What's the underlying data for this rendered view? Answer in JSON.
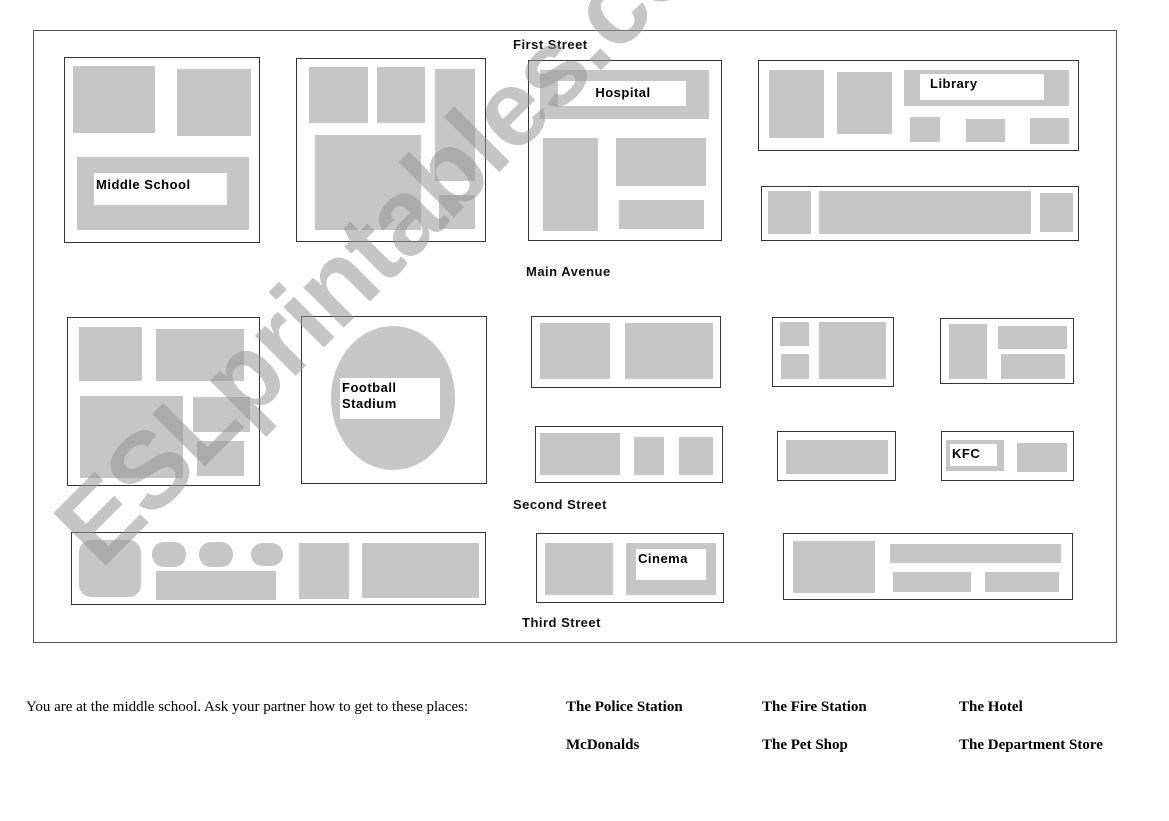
{
  "streets": {
    "first": "First Street",
    "main": "Main Avenue",
    "second": "Second Street",
    "third": "Third Street"
  },
  "places": {
    "middle_school": "Middle School",
    "hospital": "Hospital",
    "library": "Library",
    "football_stadium": "Football Stadium",
    "kfc": "KFC",
    "cinema": "Cinema"
  },
  "worksheet": {
    "instruction": "You are at the middle school.  Ask your partner how to get to these places:",
    "destinations": [
      "The Police Station",
      "The Fire Station",
      "The Hotel",
      "McDonalds",
      "The Pet Shop",
      "The Department Store"
    ]
  },
  "colors": {
    "building": "#c6c6c6",
    "outline": "#333333"
  },
  "watermark": "ESLprintables.com"
}
